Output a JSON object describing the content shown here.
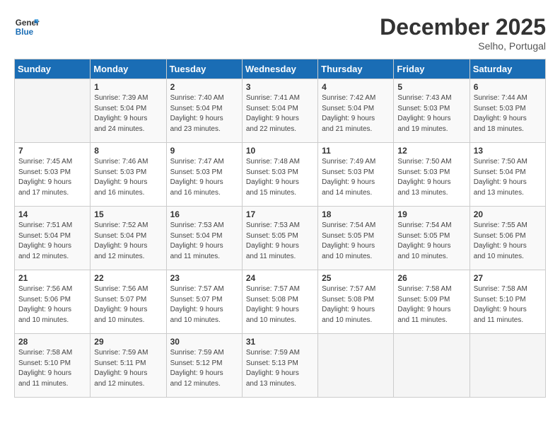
{
  "header": {
    "logo_line1": "General",
    "logo_line2": "Blue",
    "month_title": "December 2025",
    "location": "Selho, Portugal"
  },
  "days_of_week": [
    "Sunday",
    "Monday",
    "Tuesday",
    "Wednesday",
    "Thursday",
    "Friday",
    "Saturday"
  ],
  "weeks": [
    [
      {
        "day": "",
        "info": ""
      },
      {
        "day": "1",
        "info": "Sunrise: 7:39 AM\nSunset: 5:04 PM\nDaylight: 9 hours\nand 24 minutes."
      },
      {
        "day": "2",
        "info": "Sunrise: 7:40 AM\nSunset: 5:04 PM\nDaylight: 9 hours\nand 23 minutes."
      },
      {
        "day": "3",
        "info": "Sunrise: 7:41 AM\nSunset: 5:04 PM\nDaylight: 9 hours\nand 22 minutes."
      },
      {
        "day": "4",
        "info": "Sunrise: 7:42 AM\nSunset: 5:04 PM\nDaylight: 9 hours\nand 21 minutes."
      },
      {
        "day": "5",
        "info": "Sunrise: 7:43 AM\nSunset: 5:03 PM\nDaylight: 9 hours\nand 19 minutes."
      },
      {
        "day": "6",
        "info": "Sunrise: 7:44 AM\nSunset: 5:03 PM\nDaylight: 9 hours\nand 18 minutes."
      }
    ],
    [
      {
        "day": "7",
        "info": "Sunrise: 7:45 AM\nSunset: 5:03 PM\nDaylight: 9 hours\nand 17 minutes."
      },
      {
        "day": "8",
        "info": "Sunrise: 7:46 AM\nSunset: 5:03 PM\nDaylight: 9 hours\nand 16 minutes."
      },
      {
        "day": "9",
        "info": "Sunrise: 7:47 AM\nSunset: 5:03 PM\nDaylight: 9 hours\nand 16 minutes."
      },
      {
        "day": "10",
        "info": "Sunrise: 7:48 AM\nSunset: 5:03 PM\nDaylight: 9 hours\nand 15 minutes."
      },
      {
        "day": "11",
        "info": "Sunrise: 7:49 AM\nSunset: 5:03 PM\nDaylight: 9 hours\nand 14 minutes."
      },
      {
        "day": "12",
        "info": "Sunrise: 7:50 AM\nSunset: 5:03 PM\nDaylight: 9 hours\nand 13 minutes."
      },
      {
        "day": "13",
        "info": "Sunrise: 7:50 AM\nSunset: 5:04 PM\nDaylight: 9 hours\nand 13 minutes."
      }
    ],
    [
      {
        "day": "14",
        "info": "Sunrise: 7:51 AM\nSunset: 5:04 PM\nDaylight: 9 hours\nand 12 minutes."
      },
      {
        "day": "15",
        "info": "Sunrise: 7:52 AM\nSunset: 5:04 PM\nDaylight: 9 hours\nand 12 minutes."
      },
      {
        "day": "16",
        "info": "Sunrise: 7:53 AM\nSunset: 5:04 PM\nDaylight: 9 hours\nand 11 minutes."
      },
      {
        "day": "17",
        "info": "Sunrise: 7:53 AM\nSunset: 5:05 PM\nDaylight: 9 hours\nand 11 minutes."
      },
      {
        "day": "18",
        "info": "Sunrise: 7:54 AM\nSunset: 5:05 PM\nDaylight: 9 hours\nand 10 minutes."
      },
      {
        "day": "19",
        "info": "Sunrise: 7:54 AM\nSunset: 5:05 PM\nDaylight: 9 hours\nand 10 minutes."
      },
      {
        "day": "20",
        "info": "Sunrise: 7:55 AM\nSunset: 5:06 PM\nDaylight: 9 hours\nand 10 minutes."
      }
    ],
    [
      {
        "day": "21",
        "info": "Sunrise: 7:56 AM\nSunset: 5:06 PM\nDaylight: 9 hours\nand 10 minutes."
      },
      {
        "day": "22",
        "info": "Sunrise: 7:56 AM\nSunset: 5:07 PM\nDaylight: 9 hours\nand 10 minutes."
      },
      {
        "day": "23",
        "info": "Sunrise: 7:57 AM\nSunset: 5:07 PM\nDaylight: 9 hours\nand 10 minutes."
      },
      {
        "day": "24",
        "info": "Sunrise: 7:57 AM\nSunset: 5:08 PM\nDaylight: 9 hours\nand 10 minutes."
      },
      {
        "day": "25",
        "info": "Sunrise: 7:57 AM\nSunset: 5:08 PM\nDaylight: 9 hours\nand 10 minutes."
      },
      {
        "day": "26",
        "info": "Sunrise: 7:58 AM\nSunset: 5:09 PM\nDaylight: 9 hours\nand 11 minutes."
      },
      {
        "day": "27",
        "info": "Sunrise: 7:58 AM\nSunset: 5:10 PM\nDaylight: 9 hours\nand 11 minutes."
      }
    ],
    [
      {
        "day": "28",
        "info": "Sunrise: 7:58 AM\nSunset: 5:10 PM\nDaylight: 9 hours\nand 11 minutes."
      },
      {
        "day": "29",
        "info": "Sunrise: 7:59 AM\nSunset: 5:11 PM\nDaylight: 9 hours\nand 12 minutes."
      },
      {
        "day": "30",
        "info": "Sunrise: 7:59 AM\nSunset: 5:12 PM\nDaylight: 9 hours\nand 12 minutes."
      },
      {
        "day": "31",
        "info": "Sunrise: 7:59 AM\nSunset: 5:13 PM\nDaylight: 9 hours\nand 13 minutes."
      },
      {
        "day": "",
        "info": ""
      },
      {
        "day": "",
        "info": ""
      },
      {
        "day": "",
        "info": ""
      }
    ]
  ]
}
